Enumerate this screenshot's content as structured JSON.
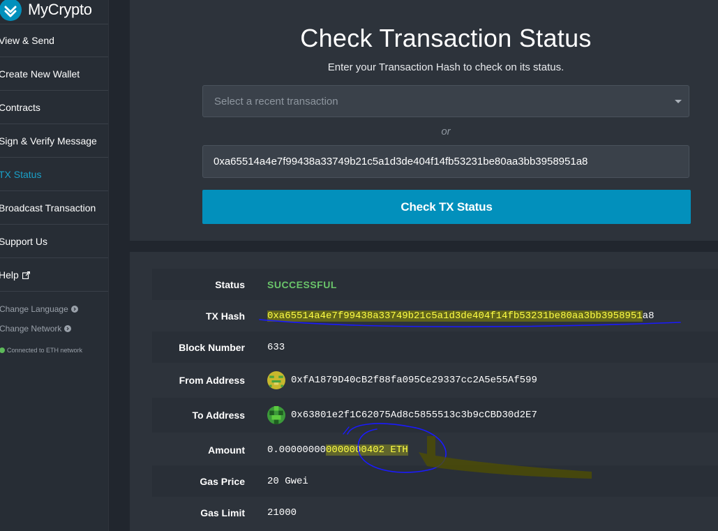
{
  "app": {
    "name": "MyCrypto"
  },
  "sidebar": {
    "items": [
      {
        "label": "View & Send"
      },
      {
        "label": "Create New Wallet"
      },
      {
        "label": "Contracts"
      },
      {
        "label": "Sign & Verify Message"
      },
      {
        "label": "TX Status",
        "active": true
      },
      {
        "label": "Broadcast Transaction"
      },
      {
        "label": "Support Us"
      },
      {
        "label": "Help",
        "icon": "external-link-icon"
      }
    ],
    "change_language": "Change Language",
    "change_network": "Change Network",
    "network_status": "Connected to ETH network"
  },
  "check": {
    "title": "Check Transaction Status",
    "subtitle": "Enter your Transaction Hash to check on its status.",
    "select_placeholder": "Select a recent transaction",
    "or_text": "or",
    "hash_value": "0xa65514a4e7f99438a33749b21c5a1d3de404f14fb53231be80aa3bb3958951a8",
    "button_label": "Check TX Status"
  },
  "result": {
    "status_label": "Status",
    "status_value": "SUCCESSFUL",
    "tx_hash_label": "TX Hash",
    "tx_hash_main": "0xa65514a4e7f99438a33749b21c5a1d3de404f14fb53231be80aa3bb3958951",
    "tx_hash_tail": "a8",
    "block_label": "Block Number",
    "block_value": "633",
    "from_label": "From Address",
    "from_value": "0xfA1879D40cB2f88fa095Ce29337cc2A5e55Af599",
    "to_label": "To Address",
    "to_value": "0x63801e2f1C62075Ad8c5855513c3b9cCBD30d2E7",
    "amount_label": "Amount",
    "amount_part1": "0.00000000",
    "amount_part2": "0000000402 ETH",
    "gas_price_label": "Gas Price",
    "gas_price_value": "20 Gwei",
    "gas_limit_label": "Gas Limit",
    "gas_limit_value": "21000"
  },
  "colors": {
    "accent": "#0290bc",
    "active_nav": "#1aa0c8",
    "success": "#6ac46a",
    "highlight": "#ffff44",
    "annotation_pen": "#1a1aff"
  }
}
